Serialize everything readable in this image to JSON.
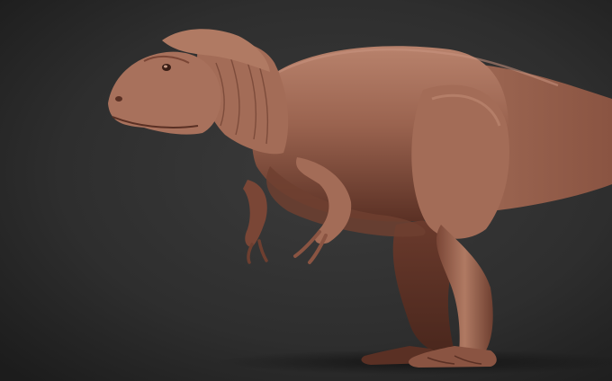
{
  "scene": {
    "subject": "dinosaur-sculpt",
    "colors": {
      "background_center": "#3a3a3a",
      "background_edge": "#1c1c1c",
      "skin_light": "#b8826c",
      "skin_mid": "#9a634f",
      "skin_dark": "#6e3f30",
      "skin_shadow": "#4a271d",
      "ground_shadow": "#141414"
    }
  }
}
